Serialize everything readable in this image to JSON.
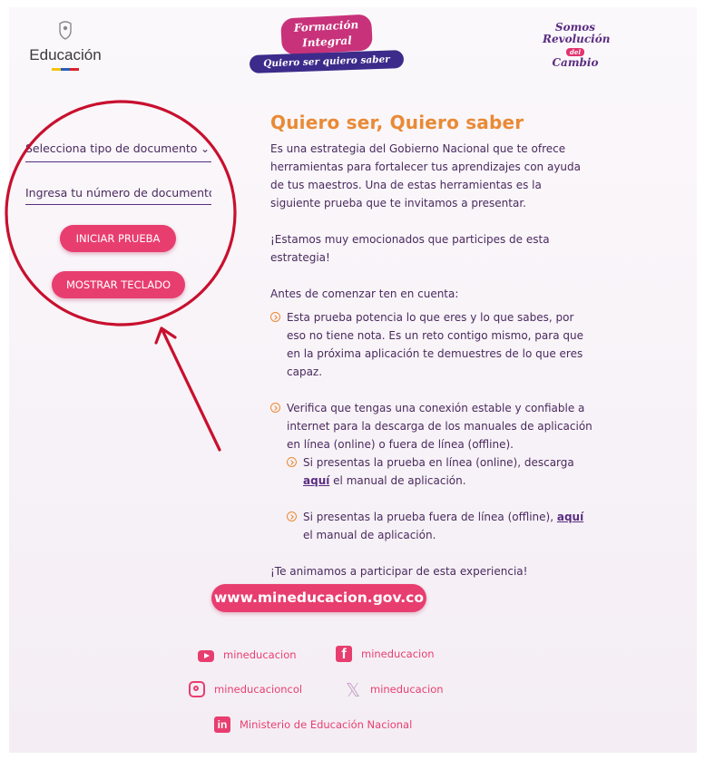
{
  "header": {
    "edu_logo_text": "Educación",
    "formacion_line1": "Formación",
    "formacion_line2": "Integral",
    "formacion_tagline": "Quiero ser quiero saber",
    "somos_line1": "Somos",
    "somos_line2": "Revolución",
    "somos_del": "del",
    "somos_line3": "Cambio"
  },
  "form": {
    "document_type_label": "Selecciona tipo de documento",
    "document_number_placeholder": "Ingresa tu número de documento",
    "start_button": "INICIAR PRUEBA",
    "keyboard_button": "MOSTRAR TECLADO"
  },
  "content": {
    "title": "Quiero ser, Quiero saber",
    "intro": "Es una estrategia del Gobierno Nacional que te ofrece herramientas para fortalecer tus aprendizajes con ayuda de tus maestros. Una de estas herramientas es la siguiente prueba que te invitamos a presentar.",
    "excited": "¡Estamos muy emocionados que participes de esta estrategia!",
    "before": "Antes de comenzar ten en cuenta:",
    "bullet1": "Esta prueba potencia lo que eres y lo que sabes, por eso no tiene nota. Es un reto contigo mismo, para que en la próxima aplicación te demuestres de lo que eres capaz.",
    "bullet2": "Verifica que tengas una conexión estable y confiable a internet para la descarga de los manuales de aplicación en línea (online) o fuera de línea (offline).",
    "sub1_text": "Si presentas la prueba en línea (online), descarga ",
    "sub1_link": "aquí",
    "sub1_tail": " el manual de aplicación.",
    "sub2_text": "Si presentas la prueba fuera de línea (offline), ",
    "sub2_link": "aquí",
    "sub2_tail": " el manual de aplicación.",
    "closing": "¡Te animamos a participar de esta experiencia!"
  },
  "footer": {
    "url": "www.mineducacion.gov.co",
    "youtube": "mineducacion",
    "facebook": "mineducacion",
    "instagram": "mineducacioncol",
    "x": "mineducacion",
    "linkedin": "Ministerio de Educación Nacional"
  },
  "colors": {
    "accent_pink": "#e83e6f",
    "title_orange": "#e98a36",
    "text_purple": "#4a2a5e",
    "annotation_red": "#c8102e"
  },
  "icons": [
    "shield-icon",
    "chevron-down-icon",
    "chevron-circle-icon",
    "youtube-icon",
    "facebook-icon",
    "instagram-icon",
    "x-icon",
    "linkedin-icon"
  ]
}
